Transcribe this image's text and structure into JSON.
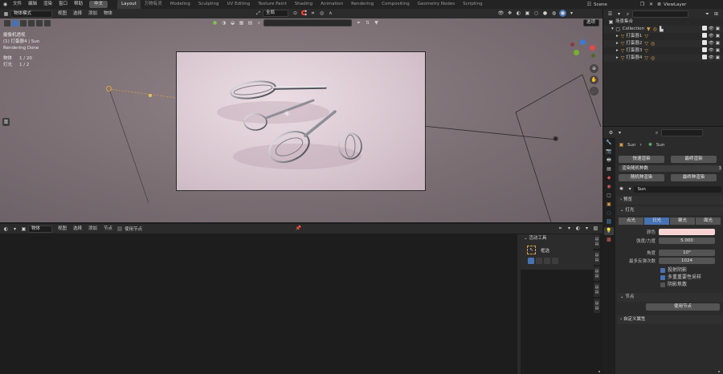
{
  "top_menu": {
    "items": [
      "文件",
      "编辑",
      "渲染",
      "窗口",
      "帮助"
    ],
    "lang": "中文",
    "workspaces": [
      "Layout",
      "万物有灵",
      "Modeling",
      "Sculpting",
      "UV Editing",
      "Texture Paint",
      "Shading",
      "Animation",
      "Rendering",
      "Compositing",
      "Geometry Nodes",
      "Scripting"
    ],
    "active_workspace": "Layout",
    "scene": "Scene",
    "view_layer": "ViewLayer"
  },
  "viewport_header": {
    "mode": "物体模式",
    "menus": [
      "视图",
      "选择",
      "添加",
      "物体"
    ],
    "transform_orientation": "全局",
    "options": "选项"
  },
  "viewport_overlay": {
    "camera_label": "摄像机透视",
    "active_object": "(1) 打蛋器4 | Sun",
    "status": "Rendering Done",
    "objects_label": "物体",
    "objects_value": "1 / 20",
    "lights_label": "灯光",
    "lights_value": "1 / 2"
  },
  "gizmo": {
    "x_label": "X",
    "y_label": "Y",
    "z_label": "Z",
    "x_color": "#e5484d",
    "y_color": "#78b22c",
    "z_color": "#3b7ad9"
  },
  "outliner": {
    "title": "场景集合",
    "rows": [
      {
        "name": "Collection",
        "depth": 1
      },
      {
        "name": "打蛋器1",
        "depth": 2
      },
      {
        "name": "打蛋器2",
        "depth": 2
      },
      {
        "name": "打蛋器3",
        "depth": 2
      },
      {
        "name": "打蛋器4",
        "depth": 2
      }
    ]
  },
  "properties": {
    "breadcrumb_object": "Sun",
    "breadcrumb_data": "Sun",
    "quick_render_button": "快速渲染",
    "final_render_button": "最终渲染",
    "seed_label": "渲染随机种数",
    "seed_value": "3",
    "random_seed_button": "随机种渲染",
    "final_seed_button": "最终种渲染",
    "datablock_name": "Sun",
    "preview_panel": "预览",
    "light_panel": "灯光",
    "light_types": [
      "点光",
      "日光",
      "聚光",
      "面光"
    ],
    "active_light_type": "日光",
    "color_label": "颜色",
    "color_value": "#f7d4d2",
    "strength_label": "强度/力度",
    "strength_value": "5.000",
    "angle_label": "角度",
    "angle_value": "10°",
    "max_bounces_label": "最多反弹次数",
    "max_bounces_value": "1024",
    "cast_shadow": "投射阴影",
    "multiple_importance": "多重重要性采样",
    "shadow_caustics": "阴影焦散",
    "nodes_panel": "节点",
    "use_nodes_button": "使用节点",
    "custom_props_panel": "自定义属性"
  },
  "node_editor": {
    "object_dd": "物体",
    "menus": [
      "视图",
      "选择",
      "添加",
      "节点"
    ],
    "use_nodes": "使用节点",
    "active_tool_title": "活动工具",
    "tool_name": "框选"
  },
  "colors": {
    "accent": "#4772b3",
    "panel": "#2b2b2b",
    "light_orange": "#e0a04a"
  }
}
